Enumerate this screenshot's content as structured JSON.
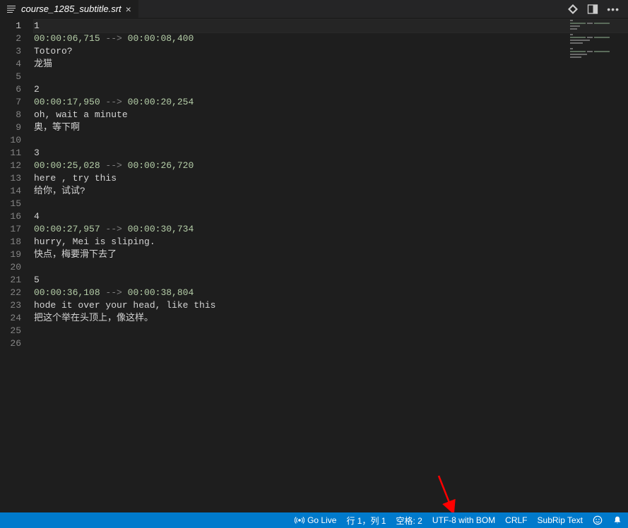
{
  "tab": {
    "title": "course_1285_subtitle.srt"
  },
  "lines": [
    {
      "n": 1,
      "segs": [
        {
          "t": "1",
          "c": "tok-text"
        }
      ]
    },
    {
      "n": 2,
      "segs": [
        {
          "t": "00:00:06,715",
          "c": "tok-num"
        },
        {
          "t": " --> ",
          "c": "tok-arrow"
        },
        {
          "t": "00:00:08,400",
          "c": "tok-num"
        }
      ]
    },
    {
      "n": 3,
      "segs": [
        {
          "t": "Totoro?",
          "c": "tok-text"
        }
      ]
    },
    {
      "n": 4,
      "segs": [
        {
          "t": "龙猫",
          "c": "tok-text"
        }
      ]
    },
    {
      "n": 5,
      "segs": []
    },
    {
      "n": 6,
      "segs": [
        {
          "t": "2",
          "c": "tok-text"
        }
      ]
    },
    {
      "n": 7,
      "segs": [
        {
          "t": "00:00:17,950",
          "c": "tok-num"
        },
        {
          "t": " --> ",
          "c": "tok-arrow"
        },
        {
          "t": "00:00:20,254",
          "c": "tok-num"
        }
      ]
    },
    {
      "n": 8,
      "segs": [
        {
          "t": "oh, wait a minute",
          "c": "tok-text"
        }
      ]
    },
    {
      "n": 9,
      "segs": [
        {
          "t": "奥，等下啊",
          "c": "tok-text"
        }
      ]
    },
    {
      "n": 10,
      "segs": []
    },
    {
      "n": 11,
      "segs": [
        {
          "t": "3",
          "c": "tok-text"
        }
      ]
    },
    {
      "n": 12,
      "segs": [
        {
          "t": "00:00:25,028",
          "c": "tok-num"
        },
        {
          "t": " --> ",
          "c": "tok-arrow"
        },
        {
          "t": "00:00:26,720",
          "c": "tok-num"
        }
      ]
    },
    {
      "n": 13,
      "segs": [
        {
          "t": "here , try this",
          "c": "tok-text"
        }
      ]
    },
    {
      "n": 14,
      "segs": [
        {
          "t": "给你，试试?",
          "c": "tok-text"
        }
      ]
    },
    {
      "n": 15,
      "segs": []
    },
    {
      "n": 16,
      "segs": [
        {
          "t": "4",
          "c": "tok-text"
        }
      ]
    },
    {
      "n": 17,
      "segs": [
        {
          "t": "00:00:27,957",
          "c": "tok-num"
        },
        {
          "t": " --> ",
          "c": "tok-arrow"
        },
        {
          "t": "00:00:30,734",
          "c": "tok-num"
        }
      ]
    },
    {
      "n": 18,
      "segs": [
        {
          "t": "hurry, Mei is sliping.",
          "c": "tok-text"
        }
      ]
    },
    {
      "n": 19,
      "segs": [
        {
          "t": "快点，梅要滑下去了",
          "c": "tok-text"
        }
      ]
    },
    {
      "n": 20,
      "segs": []
    },
    {
      "n": 21,
      "segs": [
        {
          "t": "5",
          "c": "tok-text"
        }
      ]
    },
    {
      "n": 22,
      "segs": [
        {
          "t": "00:00:36,108",
          "c": "tok-num"
        },
        {
          "t": " --> ",
          "c": "tok-arrow"
        },
        {
          "t": "00:00:38,804",
          "c": "tok-num"
        }
      ]
    },
    {
      "n": 23,
      "segs": [
        {
          "t": "hode it over your head, like this",
          "c": "tok-text"
        }
      ]
    },
    {
      "n": 24,
      "segs": [
        {
          "t": "把这个举在头顶上，像这样。",
          "c": "tok-text"
        }
      ]
    },
    {
      "n": 25,
      "segs": []
    },
    {
      "n": 26,
      "segs": []
    }
  ],
  "status": {
    "go_live": "Go Live",
    "cursor": "行 1，列 1",
    "spaces": "空格: 2",
    "encoding": "UTF-8 with BOM",
    "eol": "CRLF",
    "lang": "SubRip Text"
  }
}
